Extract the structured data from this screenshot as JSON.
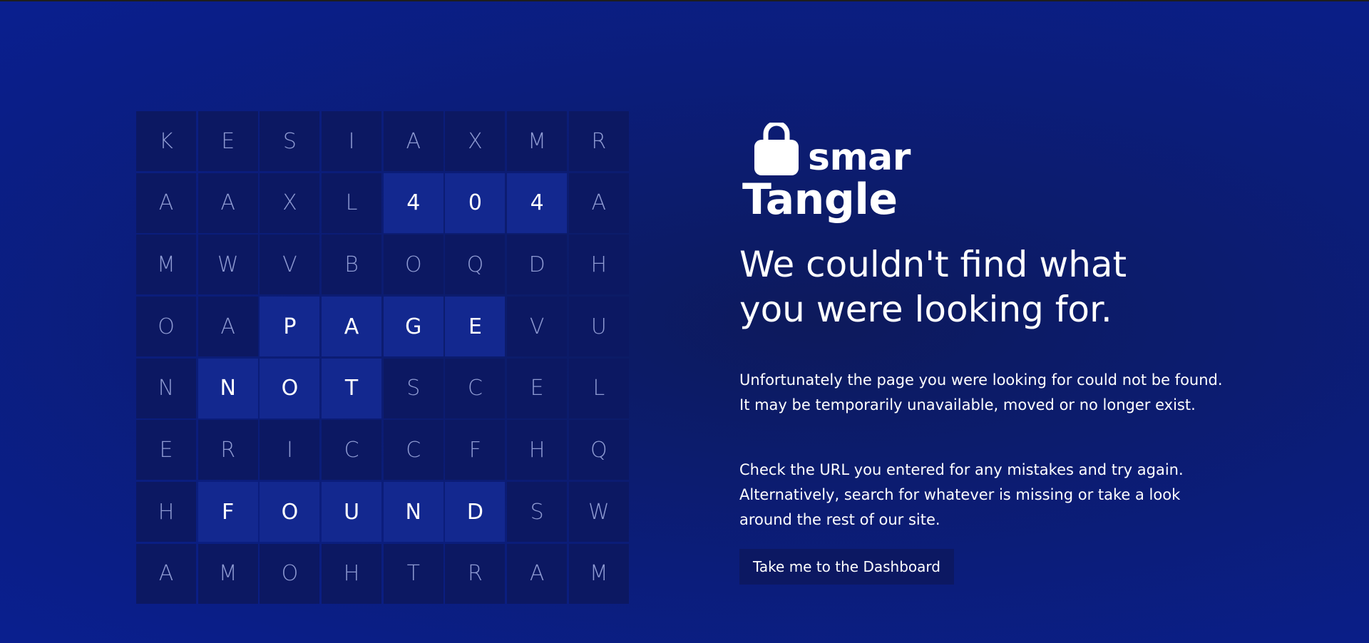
{
  "grid": {
    "rows": [
      [
        "K",
        "E",
        "S",
        "I",
        "A",
        "X",
        "M",
        "R"
      ],
      [
        "A",
        "A",
        "X",
        "L",
        "4",
        "0",
        "4",
        "A"
      ],
      [
        "M",
        "W",
        "V",
        "B",
        "O",
        "Q",
        "D",
        "H"
      ],
      [
        "O",
        "A",
        "P",
        "A",
        "G",
        "E",
        "V",
        "U"
      ],
      [
        "N",
        "N",
        "O",
        "T",
        "S",
        "C",
        "E",
        "L"
      ],
      [
        "E",
        "R",
        "I",
        "C",
        "C",
        "F",
        "H",
        "Q"
      ],
      [
        "H",
        "F",
        "O",
        "U",
        "N",
        "D",
        "S",
        "W"
      ],
      [
        "A",
        "M",
        "O",
        "H",
        "T",
        "R",
        "A",
        "M"
      ]
    ],
    "highlighted": [
      [
        1,
        4
      ],
      [
        1,
        5
      ],
      [
        1,
        6
      ],
      [
        3,
        2
      ],
      [
        3,
        3
      ],
      [
        3,
        4
      ],
      [
        3,
        5
      ],
      [
        4,
        1
      ],
      [
        4,
        2
      ],
      [
        4,
        3
      ],
      [
        6,
        1
      ],
      [
        6,
        2
      ],
      [
        6,
        3
      ],
      [
        6,
        4
      ],
      [
        6,
        5
      ]
    ]
  },
  "logo": {
    "line1": "smar",
    "line2": "Tangle",
    "icon": "shopping-bag-icon"
  },
  "headline": "We couldn't find what you were looking for.",
  "paragraphs": {
    "p1": "Unfortunately the page you were looking for could not be found. It may be temporarily unavailable, moved or no longer exist.",
    "p2": "Check the URL you entered for any mistakes and try again. Alternatively, search for whatever is missing or take a look around the rest of our site."
  },
  "button": {
    "label": "Take me to the Dashboard"
  },
  "colors": {
    "background": "#0b1d7a",
    "cell": "#0c1862",
    "cell_highlight": "#13288f",
    "cell_text": "#8f9bd3",
    "text": "#ffffff"
  }
}
